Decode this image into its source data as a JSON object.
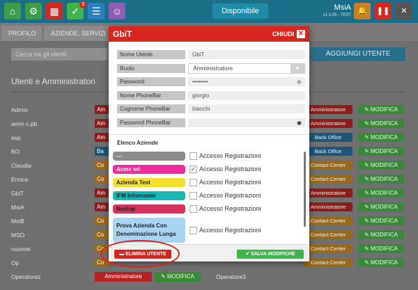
{
  "topbar": {
    "icons": [
      {
        "name": "home-icon",
        "glyph": "⌂",
        "color": "#3b9e4a"
      },
      {
        "name": "gear-icon",
        "glyph": "⚙",
        "color": "#3b9e4a"
      },
      {
        "name": "calendar-icon",
        "glyph": "▦",
        "color": "#d9261c"
      },
      {
        "name": "check-icon",
        "glyph": "✓",
        "color": "#3eb54a",
        "badge": "3"
      },
      {
        "name": "list-icon",
        "glyph": "☰",
        "color": "#2a7fc0"
      },
      {
        "name": "users-icon",
        "glyph": "☺",
        "color": "#8e5bb5"
      }
    ],
    "status": "Disponibile",
    "user_name": "MsiA",
    "user_version": "v1.3.05 - TEST",
    "right_icons": [
      {
        "name": "bell-icon",
        "glyph": "🔔",
        "color": "#c87f2a"
      },
      {
        "name": "pause-icon",
        "glyph": "❚❚",
        "color": "#d9261c"
      },
      {
        "name": "close-app-icon",
        "glyph": "✕",
        "color": "#555555"
      }
    ]
  },
  "tabs": [
    "PROFILO",
    "AZIENDE, SERVIZI"
  ],
  "background": {
    "search_placeholder": "Cerca tra gli utenti",
    "add_user": "AGGIUNGI UTENTE",
    "section_title": "Utenti e Amministratori",
    "rows": [
      {
        "name": "Admin",
        "left": "Am",
        "left_color": "red",
        "right": "Amministratore",
        "right_color": "red"
      },
      {
        "name": "amm c.pb",
        "left": "Am",
        "left_color": "red",
        "right": "Amministratore",
        "right_color": "red"
      },
      {
        "name": "asp",
        "left": "Am",
        "left_color": "red",
        "right": "Back Office",
        "right_color": "blue"
      },
      {
        "name": "BO",
        "left": "Ba",
        "left_color": "blue",
        "right": "Back Office",
        "right_color": "blue"
      },
      {
        "name": "Claudia",
        "left": "Co",
        "left_color": "orange",
        "right": "Contact Center",
        "right_color": "orange"
      },
      {
        "name": "Enrica",
        "left": "Co",
        "left_color": "orange",
        "right": "Contact Center",
        "right_color": "orange"
      },
      {
        "name": "GbiT",
        "left": "Am",
        "left_color": "red",
        "right": "Amministratore",
        "right_color": "red"
      },
      {
        "name": "MsiA",
        "left": "Am",
        "left_color": "red",
        "right": "Amministratore",
        "right_color": "red"
      },
      {
        "name": "MsiB",
        "left": "Co",
        "left_color": "orange",
        "right": "Contact Center",
        "right_color": "orange"
      },
      {
        "name": "MSO",
        "left": "Co",
        "left_color": "orange",
        "right": "Contact Center",
        "right_color": "orange"
      },
      {
        "name": "nuovoe",
        "left": "Co",
        "left_color": "orange",
        "right": "Contact Center",
        "right_color": "orange"
      },
      {
        "name": "Op",
        "left": "Co",
        "left_color": "orange",
        "right": "Contact Center",
        "right_color": "orange"
      }
    ],
    "modify_label": "✎ MODIFICA",
    "last_row": {
      "name": "Operatorez",
      "role": "Amministratore",
      "modify": "✎ MODIFICA",
      "name2": "Operatore3"
    }
  },
  "modal": {
    "logo": "GbiT",
    "close_label": "CHIUDI",
    "fields": [
      {
        "label": "Nome Utente",
        "value": "GbiT",
        "type": "text"
      },
      {
        "label": "Ruolo",
        "value": "Amministratore",
        "type": "select"
      },
      {
        "label": "Password",
        "value": "••••••••",
        "type": "password"
      },
      {
        "label": "Nome PhoneBar",
        "value": "giorgio",
        "type": "text"
      },
      {
        "label": "Cognome PhoneBar",
        "value": "bianchi",
        "type": "text"
      },
      {
        "label": "Password PhoneBar",
        "value": "",
        "type": "password-dark"
      }
    ],
    "aziende_title": "Elenco Aziende",
    "companies": [
      {
        "name": "---",
        "color": "#8a8a8a",
        "text_color": "#ffffff",
        "checked": false,
        "label": "Accesso Registrazioni"
      },
      {
        "name": "Acme srl",
        "color": "#f02c9c",
        "text_color": "#ffffff",
        "checked": true,
        "label": "Accesso Registrazioni"
      },
      {
        "name": "Azienda Test",
        "color": "#f2e02a",
        "text_color": "#222222",
        "checked": false,
        "label": "Accesso Registrazioni"
      },
      {
        "name": "IFM Infomaster",
        "color": "#19b6b8",
        "text_color": "#222222",
        "checked": false,
        "label": "Accesso Registrazioni"
      },
      {
        "name": "Nextup",
        "color": "#d2325c",
        "text_color": "#222222",
        "checked": false,
        "label": "Accesso Registrazioni"
      },
      {
        "name": "Prova Azienda Con Denominazione Lunga",
        "color": "#a9d3f0",
        "text_color": "#222222",
        "checked": false,
        "label": "Accesso Registrazioni"
      }
    ],
    "delete_label": "ELIMINA UTENTE",
    "save_label": "SALVA MODIFICHE"
  }
}
